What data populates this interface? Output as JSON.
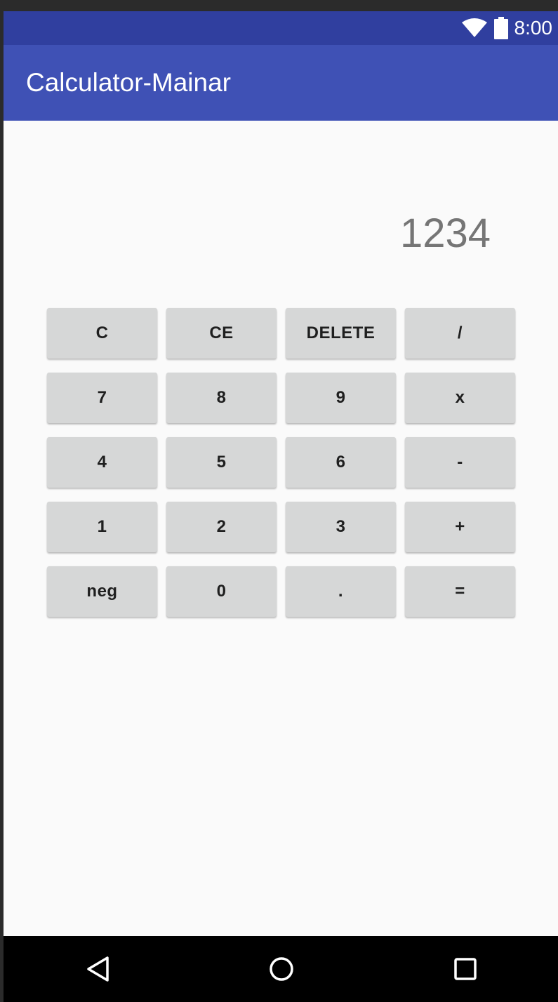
{
  "status_bar": {
    "time": "8:00",
    "icons": [
      "wifi-icon",
      "battery-icon"
    ],
    "background": "#303f9f"
  },
  "app_bar": {
    "title": "Calculator-Mainar",
    "background": "#3f51b5"
  },
  "display": {
    "value": "1234",
    "color": "#757575"
  },
  "keypad": {
    "keys": [
      {
        "label": "C",
        "name": "clear"
      },
      {
        "label": "CE",
        "name": "clear-entry"
      },
      {
        "label": "DELETE",
        "name": "delete"
      },
      {
        "label": "/",
        "name": "divide"
      },
      {
        "label": "7",
        "name": "digit-7"
      },
      {
        "label": "8",
        "name": "digit-8"
      },
      {
        "label": "9",
        "name": "digit-9"
      },
      {
        "label": "x",
        "name": "multiply"
      },
      {
        "label": "4",
        "name": "digit-4"
      },
      {
        "label": "5",
        "name": "digit-5"
      },
      {
        "label": "6",
        "name": "digit-6"
      },
      {
        "label": "-",
        "name": "subtract"
      },
      {
        "label": "1",
        "name": "digit-1"
      },
      {
        "label": "2",
        "name": "digit-2"
      },
      {
        "label": "3",
        "name": "digit-3"
      },
      {
        "label": "+",
        "name": "add"
      },
      {
        "label": "neg",
        "name": "negate"
      },
      {
        "label": "0",
        "name": "digit-0"
      },
      {
        "label": ".",
        "name": "decimal-point"
      },
      {
        "label": "=",
        "name": "equals"
      }
    ],
    "key_color": "#d6d7d7"
  },
  "nav_bar": {
    "buttons": [
      "back-icon",
      "home-icon",
      "recents-icon"
    ]
  }
}
